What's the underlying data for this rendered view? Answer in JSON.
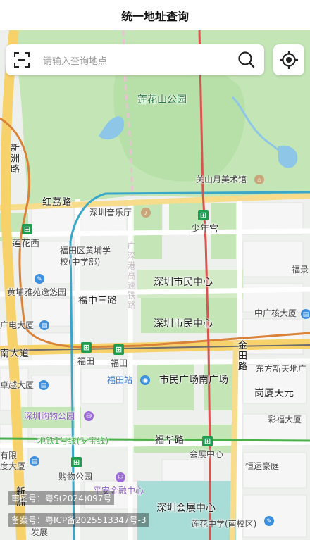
{
  "header": {
    "title": "统一地址查询"
  },
  "search": {
    "placeholder": "请输入查询地点"
  },
  "map": {
    "labels": {
      "lianhuashan_park": "莲花山公园",
      "guanshanyue": "关山月美术馆",
      "xinzhou_road": "新洲路",
      "honglizheng_road": "红荔路",
      "shenzhen_concert_hall": "深圳音乐厅",
      "shaonian_palace": "少年宫",
      "lianhuaxi": "莲花西",
      "futian_huangpu_school": "福田区黄埔学校(中学部)",
      "huangpu_yayuan": "黄埔雅苑逸悠园",
      "fuzhong_3rd_road": "福中三路",
      "civic_center_1": "深圳市民中心",
      "civic_center_2": "深圳市民中心",
      "zhongguang_building": "中广核大厦",
      "fujing": "福景",
      "guangdian": "广电大厦",
      "shennan_avenue": "南大道",
      "futian_station_metro": "福田",
      "futian_metro2": "福田",
      "futian_hub": "福田站",
      "civic_square_south": "市民广场南广场",
      "jintian_road": "金田路",
      "dongfang_xintiandi": "东方新天地广",
      "gangsha_tianyuan": "岗厦天元",
      "zhuoyue_building": "卓越大厦",
      "shenzhen_shopping_park": "深圳购物公园",
      "caifu_building": "彩福大厦",
      "fuhua_road": "福华路",
      "convention_center_metro": "会展中心",
      "line1_name": "地铁1号线(罗宝线)",
      "hengyun_building": "恒运豪庭",
      "gouwu_park": "购物公园",
      "pingan_finance": "平安金融中心",
      "convention_center": "深圳会展中心",
      "lianhuazhong_school": "莲花中学(南校区)",
      "youxian": "有限",
      "dusha": "度大厦",
      "xinzhou_south": "新洲",
      "fazhan": "发展",
      "faint_vertical": "广深港高速铁路"
    }
  },
  "footer": {
    "audit_no": "审图号：粤S(2024)097号",
    "icp_no": "备案号：粤ICP备2025513347号-3"
  },
  "colors": {
    "park_green": "#bfe3b2",
    "water_blue": "#8ec6e8",
    "metro_green": "#1f9c4e",
    "line_cyan": "#3aa7c8",
    "line_orange": "#d9823a",
    "line_red": "#d9534f",
    "line_green": "#4bb04a",
    "road_yellow": "#f7d26a"
  }
}
